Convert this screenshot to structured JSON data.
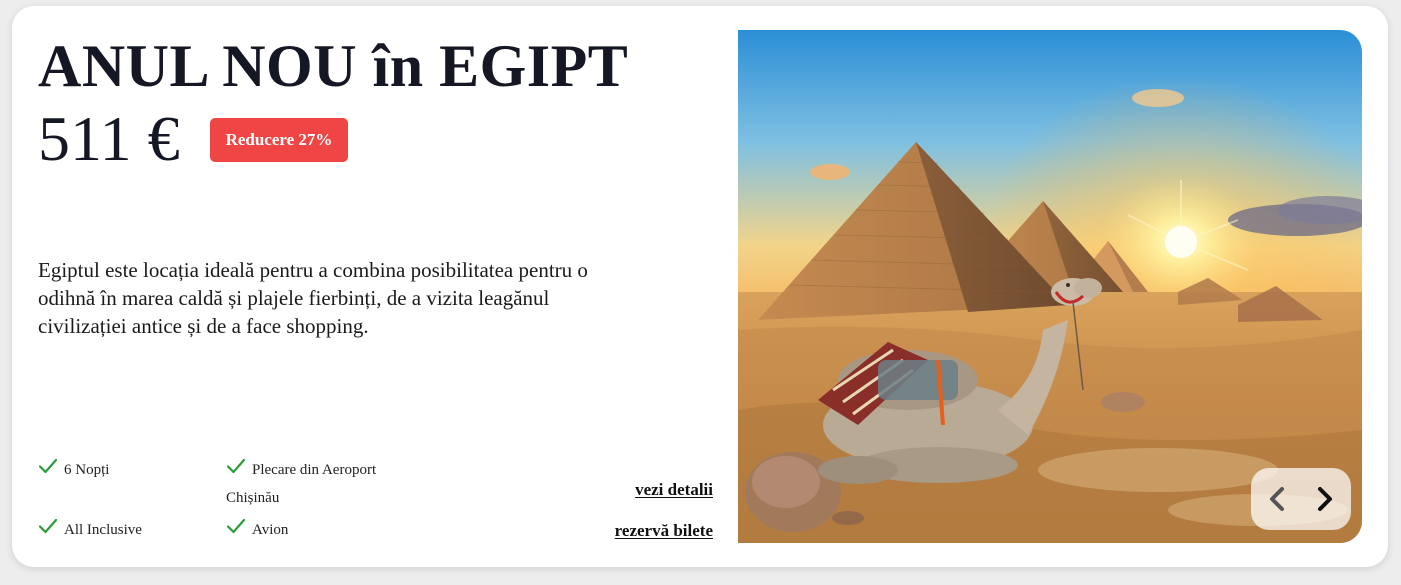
{
  "offer": {
    "title": "ANUL NOU în EGIPT",
    "price": "511 €",
    "discount_badge": "Reducere 27%",
    "description": "Egiptul este locația ideală pentru a combina posibilitatea pentru o odihnă în marea caldă și plajele fierbinți, de a vizita leagănul civilizației antice și de a face shopping."
  },
  "features": {
    "nights": "6 Nopți",
    "departure_line1": "Plecare din Aeroport",
    "departure_line2": "Chișinău",
    "meals": "All Inclusive",
    "transport": "Avion"
  },
  "actions": {
    "details_link": "vezi detalii",
    "book_link": "rezervă bilete"
  },
  "image": {
    "subject": "pyramids-camel-sunset-photo"
  },
  "colors": {
    "badge": "#f04545",
    "check": "#2e9b3b",
    "text": "#151824"
  },
  "icons": {
    "check": "check-icon",
    "prev": "chevron-left-icon",
    "next": "chevron-right-icon"
  }
}
